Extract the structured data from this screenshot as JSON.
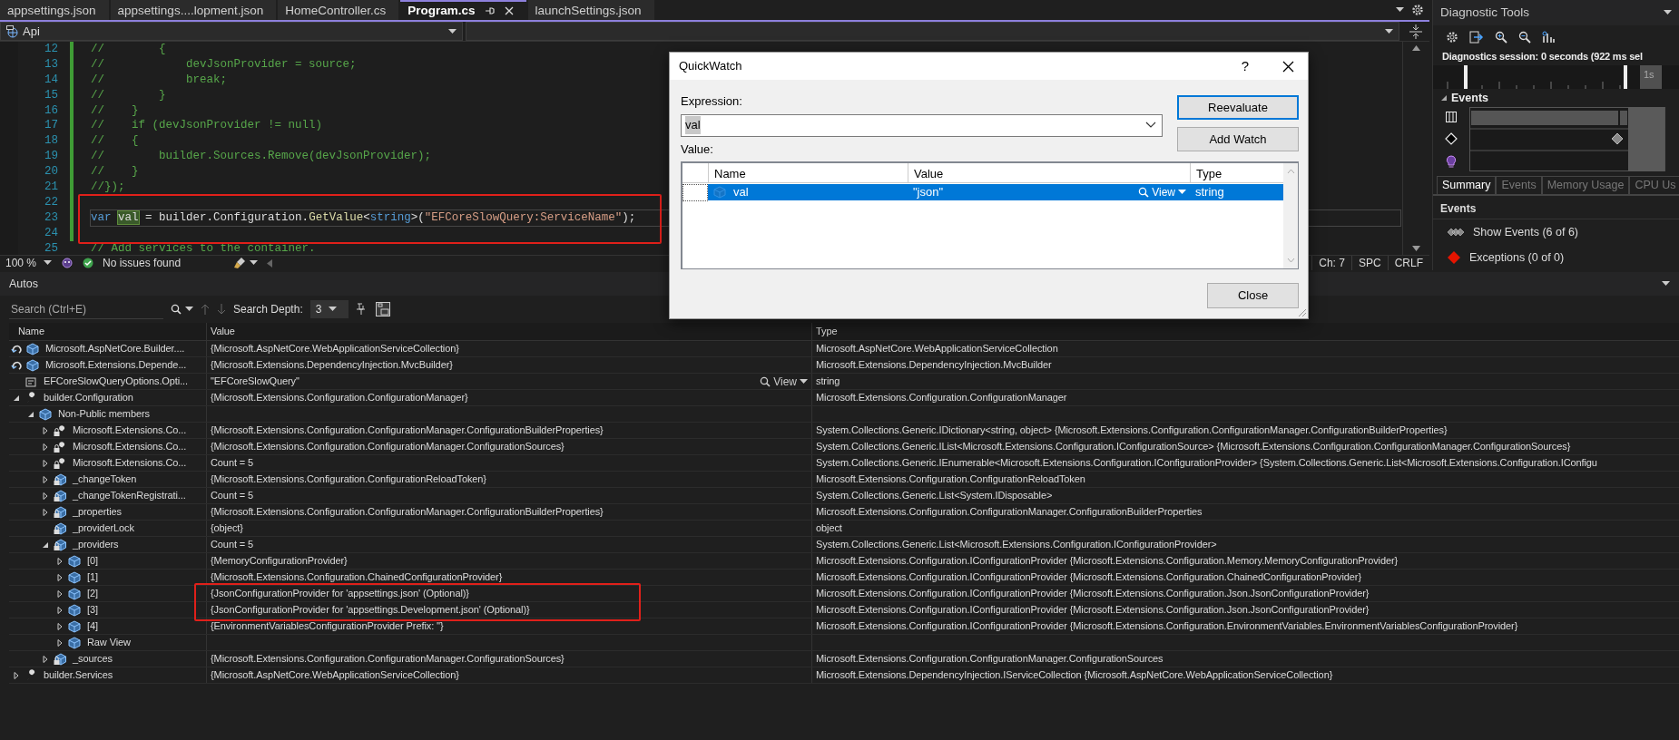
{
  "editor_tabs": [
    {
      "label": "appsettings.json",
      "selected": false
    },
    {
      "label": "appsettings....lopment.json",
      "selected": false
    },
    {
      "label": "HomeController.cs",
      "selected": false
    },
    {
      "label": "Program.cs",
      "selected": true
    },
    {
      "label": "launchSettings.json",
      "selected": false
    }
  ],
  "navigation": {
    "project": "Api"
  },
  "code_lines": [
    {
      "number": "12",
      "tokens": [
        {
          "kind": "comment",
          "text": "//        {"
        }
      ]
    },
    {
      "number": "13",
      "tokens": [
        {
          "kind": "comment",
          "text": "//            devJsonProvider = source;"
        }
      ]
    },
    {
      "number": "14",
      "tokens": [
        {
          "kind": "comment",
          "text": "//            break;"
        }
      ]
    },
    {
      "number": "15",
      "tokens": [
        {
          "kind": "comment",
          "text": "//        }"
        }
      ]
    },
    {
      "number": "16",
      "tokens": [
        {
          "kind": "comment",
          "text": "//    }"
        }
      ]
    },
    {
      "number": "17",
      "tokens": [
        {
          "kind": "comment",
          "text": "//    if (devJsonProvider != null)"
        }
      ]
    },
    {
      "number": "18",
      "tokens": [
        {
          "kind": "comment",
          "text": "//    {"
        }
      ]
    },
    {
      "number": "19",
      "tokens": [
        {
          "kind": "comment",
          "text": "//        builder.Sources.Remove(devJsonProvider);"
        }
      ]
    },
    {
      "number": "20",
      "tokens": [
        {
          "kind": "comment",
          "text": "//    }"
        }
      ]
    },
    {
      "number": "21",
      "tokens": [
        {
          "kind": "comment",
          "text": "//});"
        }
      ]
    },
    {
      "number": "22",
      "boxed": true
    },
    {
      "number": "23",
      "boxed": true,
      "current": true,
      "tokens": [
        {
          "kind": "keyword",
          "text": "var "
        },
        {
          "kind": "highlight",
          "text": "val"
        },
        {
          "kind": "plain",
          "text": " = "
        },
        {
          "kind": "ident",
          "text": "builder"
        },
        {
          "kind": "plain",
          "text": "."
        },
        {
          "kind": "ident",
          "text": "Configuration"
        },
        {
          "kind": "plain",
          "text": "."
        },
        {
          "kind": "method",
          "text": "GetValue"
        },
        {
          "kind": "plain",
          "text": "<"
        },
        {
          "kind": "keyword",
          "text": "string"
        },
        {
          "kind": "plain",
          "text": ">("
        },
        {
          "kind": "string",
          "text": "\"EFCoreSlowQuery:ServiceName\""
        },
        {
          "kind": "plain",
          "text": ");"
        }
      ]
    },
    {
      "number": "24",
      "boxed": true
    },
    {
      "number": "25",
      "tokens": [
        {
          "kind": "comment",
          "text": "// Add services to the container."
        }
      ]
    }
  ],
  "editor_status": {
    "zoom": "100 %",
    "issues": "No issues found",
    "position": "Ch: 7",
    "indent": "SPC",
    "line_ending": "CRLF"
  },
  "diagnostic_tools": {
    "title": "Diagnostic Tools",
    "session": "Diagnostics session: 0 seconds (922 ms sel",
    "timeline_label": "1s",
    "events_heading": "Events",
    "tabs": [
      {
        "label": "Summary",
        "selected": true
      },
      {
        "label": "Events",
        "selected": false
      },
      {
        "label": "Memory Usage",
        "selected": false
      },
      {
        "label": "CPU Us",
        "selected": false
      }
    ],
    "summary_heading": "Events",
    "links": [
      {
        "kind": "events",
        "label": "Show Events (6 of 6)"
      },
      {
        "kind": "exceptions",
        "label": "Exceptions (0 of 0)"
      }
    ]
  },
  "autos": {
    "title": "Autos",
    "search_placeholder": "Search (Ctrl+E)",
    "depth_label": "Search Depth:",
    "depth": "3",
    "columns": [
      "Name",
      "Value",
      "Type"
    ],
    "rows": [
      {
        "kind": "returned",
        "name": "Microsoft.AspNetCore.Builder....",
        "value": "{Microsoft.AspNetCore.WebApplicationServiceCollection}",
        "type": "Microsoft.AspNetCore.WebApplicationServiceCollection"
      },
      {
        "kind": "returned",
        "name": "Microsoft.Extensions.Depende...",
        "value": "{Microsoft.Extensions.DependencyInjection.MvcBuilder}",
        "type": "Microsoft.Extensions.DependencyInjection.MvcBuilder"
      },
      {
        "kind": "field",
        "name": "EFCoreSlowQueryOptions.Opti...",
        "value": "\"EFCoreSlowQuery\"",
        "view": "View",
        "type": "string"
      },
      {
        "kind": "property",
        "expanded": true,
        "name": "builder.Configuration",
        "value": "{Microsoft.Extensions.Configuration.ConfigurationManager}",
        "type": "Microsoft.Extensions.Configuration.ConfigurationManager",
        "children": [
          {
            "kind": "object",
            "expanded": true,
            "name": "Non-Public members",
            "children": [
              {
                "kind": "private-property",
                "expanded": false,
                "name": "Microsoft.Extensions.Co...",
                "value": "{Microsoft.Extensions.Configuration.ConfigurationManager.ConfigurationBuilderProperties}",
                "type": "System.Collections.Generic.IDictionary<string, object> {Microsoft.Extensions.Configuration.ConfigurationManager.ConfigurationBuilderProperties}"
              },
              {
                "kind": "private-property",
                "expanded": false,
                "name": "Microsoft.Extensions.Co...",
                "value": "{Microsoft.Extensions.Configuration.ConfigurationManager.ConfigurationSources}",
                "type": "System.Collections.Generic.IList<Microsoft.Extensions.Configuration.IConfigurationSource> {Microsoft.Extensions.Configuration.ConfigurationManager.ConfigurationSources}"
              },
              {
                "kind": "private-property",
                "expanded": false,
                "name": "Microsoft.Extensions.Co...",
                "value": "Count = 5",
                "type": "System.Collections.Generic.IEnumerable<Microsoft.Extensions.Configuration.IConfigurationProvider> {System.Collections.Generic.List<Microsoft.Extensions.Configuration.IConfigu"
              },
              {
                "kind": "private-field",
                "expanded": false,
                "name": "_changeToken",
                "value": "{Microsoft.Extensions.Configuration.ConfigurationReloadToken}",
                "type": "Microsoft.Extensions.Configuration.ConfigurationReloadToken"
              },
              {
                "kind": "private-field",
                "expanded": false,
                "name": "_changeTokenRegistrati...",
                "value": "Count = 5",
                "type": "System.Collections.Generic.List<System.IDisposable>"
              },
              {
                "kind": "private-field",
                "expanded": false,
                "name": "_properties",
                "value": "{Microsoft.Extensions.Configuration.ConfigurationManager.ConfigurationBuilderProperties}",
                "type": "Microsoft.Extensions.Configuration.ConfigurationManager.ConfigurationBuilderProperties"
              },
              {
                "kind": "private-field",
                "name": "_providerLock",
                "value": "{object}",
                "type": "object"
              },
              {
                "kind": "private-field",
                "expanded": true,
                "name": "_providers",
                "value": "Count = 5",
                "type": "System.Collections.Generic.List<Microsoft.Extensions.Configuration.IConfigurationProvider>",
                "children": [
                  {
                    "kind": "object",
                    "expanded": false,
                    "name": "[0]",
                    "value": "{MemoryConfigurationProvider}",
                    "type": "Microsoft.Extensions.Configuration.IConfigurationProvider {Microsoft.Extensions.Configuration.Memory.MemoryConfigurationProvider}"
                  },
                  {
                    "kind": "object",
                    "expanded": false,
                    "name": "[1]",
                    "value": "{Microsoft.Extensions.Configuration.ChainedConfigurationProvider}",
                    "type": "Microsoft.Extensions.Configuration.IConfigurationProvider {Microsoft.Extensions.Configuration.ChainedConfigurationProvider}"
                  },
                  {
                    "kind": "object",
                    "expanded": false,
                    "boxed": true,
                    "name": "[2]",
                    "value": "{JsonConfigurationProvider for 'appsettings.json' (Optional)}",
                    "type": "Microsoft.Extensions.Configuration.IConfigurationProvider {Microsoft.Extensions.Configuration.Json.JsonConfigurationProvider}"
                  },
                  {
                    "kind": "object",
                    "expanded": false,
                    "boxed": true,
                    "name": "[3]",
                    "value": "{JsonConfigurationProvider for 'appsettings.Development.json' (Optional)}",
                    "type": "Microsoft.Extensions.Configuration.IConfigurationProvider {Microsoft.Extensions.Configuration.Json.JsonConfigurationProvider}"
                  },
                  {
                    "kind": "object",
                    "expanded": false,
                    "name": "[4]",
                    "value": "{EnvironmentVariablesConfigurationProvider Prefix: ''}",
                    "type": "Microsoft.Extensions.Configuration.IConfigurationProvider {Microsoft.Extensions.Configuration.EnvironmentVariables.EnvironmentVariablesConfigurationProvider}"
                  },
                  {
                    "kind": "object",
                    "expanded": false,
                    "name": "Raw View"
                  }
                ]
              },
              {
                "kind": "private-field",
                "expanded": false,
                "name": "_sources",
                "value": "{Microsoft.Extensions.Configuration.ConfigurationManager.ConfigurationSources}",
                "type": "Microsoft.Extensions.Configuration.ConfigurationManager.ConfigurationSources"
              }
            ]
          }
        ]
      },
      {
        "kind": "property",
        "expanded": false,
        "name": "builder.Services",
        "value": "{Microsoft.AspNetCore.WebApplicationServiceCollection}",
        "type": "Microsoft.Extensions.DependencyInjection.IServiceCollection {Microsoft.AspNetCore.WebApplicationServiceCollection}"
      }
    ]
  },
  "quickwatch": {
    "title": "QuickWatch",
    "help": "?",
    "expression_label": "Expression:",
    "expression": "val",
    "expression_selected": true,
    "value_label": "Value:",
    "buttons": [
      {
        "label": "Reevaluate",
        "default": true
      },
      {
        "label": "Add Watch",
        "default": false
      }
    ],
    "columns": [
      "Name",
      "Value",
      "Type"
    ],
    "rows": [
      {
        "name": "val",
        "value": "\"json\"",
        "view": "View",
        "type": "string",
        "selected": true
      }
    ],
    "close": "Close"
  }
}
